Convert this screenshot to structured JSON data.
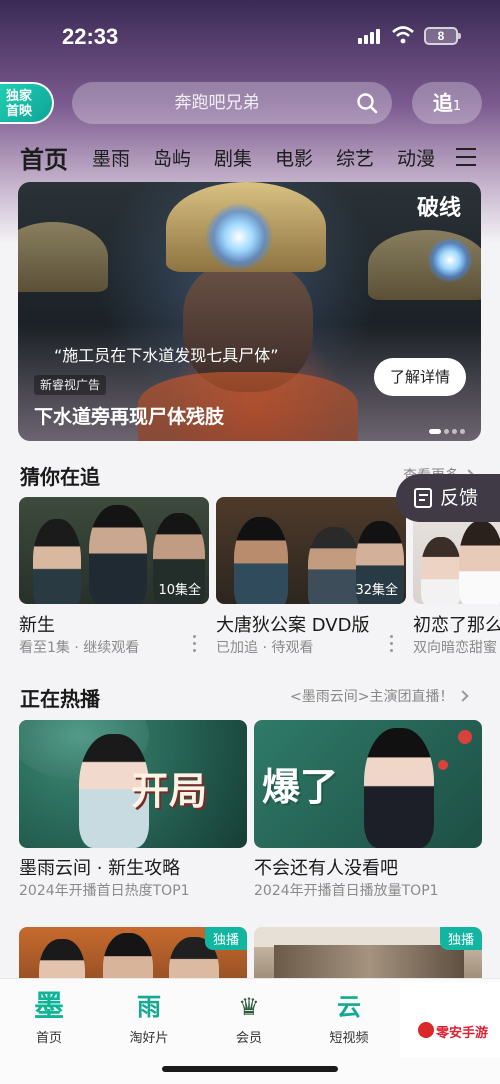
{
  "status_bar": {
    "time": "22:33",
    "battery": "8"
  },
  "header": {
    "logo_text": "独家\n首映",
    "search_placeholder": "奔跑吧兄弟",
    "chase_label": "追",
    "chase_count": "1"
  },
  "tabs": [
    "首页",
    "墨雨",
    "岛屿",
    "剧集",
    "电影",
    "综艺",
    "动漫"
  ],
  "banner": {
    "brand": "破线",
    "quote": "“施工员在下水道发现七具尸体”",
    "ad_tag": "新睿视广告",
    "title": "下水道旁再现尸体残肢",
    "detail_button": "了解详情"
  },
  "section_watching": {
    "title": "猜你在追",
    "more": "查看更多",
    "feedback": "反馈",
    "items": [
      {
        "title": "新生",
        "subtitle": "看至1集 · 继续观看",
        "badge": "10集全"
      },
      {
        "title": "大唐狄公案 DVD版",
        "subtitle": "已加追 · 待观看",
        "badge": "32集全"
      },
      {
        "title": "初恋了那么",
        "subtitle": "双向暗恋甜蜜",
        "badge": ""
      }
    ]
  },
  "section_hot": {
    "title": "正在热播",
    "more": "<墨雨云间>主演团直播！",
    "items": [
      {
        "title": "墨雨云间 · 新生攻略",
        "subtitle": "2024年开播首日热度TOP1",
        "overlay": "开局"
      },
      {
        "title": "不会还有人没看吧",
        "subtitle": "2024年开播首日播放量TOP1",
        "overlay": "爆了"
      }
    ],
    "exclusive_badge": "独播"
  },
  "bottom_nav": [
    {
      "glyph": "墨",
      "label": "首页"
    },
    {
      "glyph": "雨",
      "label": "淘好片"
    },
    {
      "glyph": "♛",
      "label": "会员"
    },
    {
      "glyph": "云",
      "label": "短视频"
    }
  ],
  "watermark": "零安手游",
  "colors": {
    "accent": "#13a993",
    "badge": "#12b6a0",
    "feedback_bg": "#3f3a46"
  }
}
